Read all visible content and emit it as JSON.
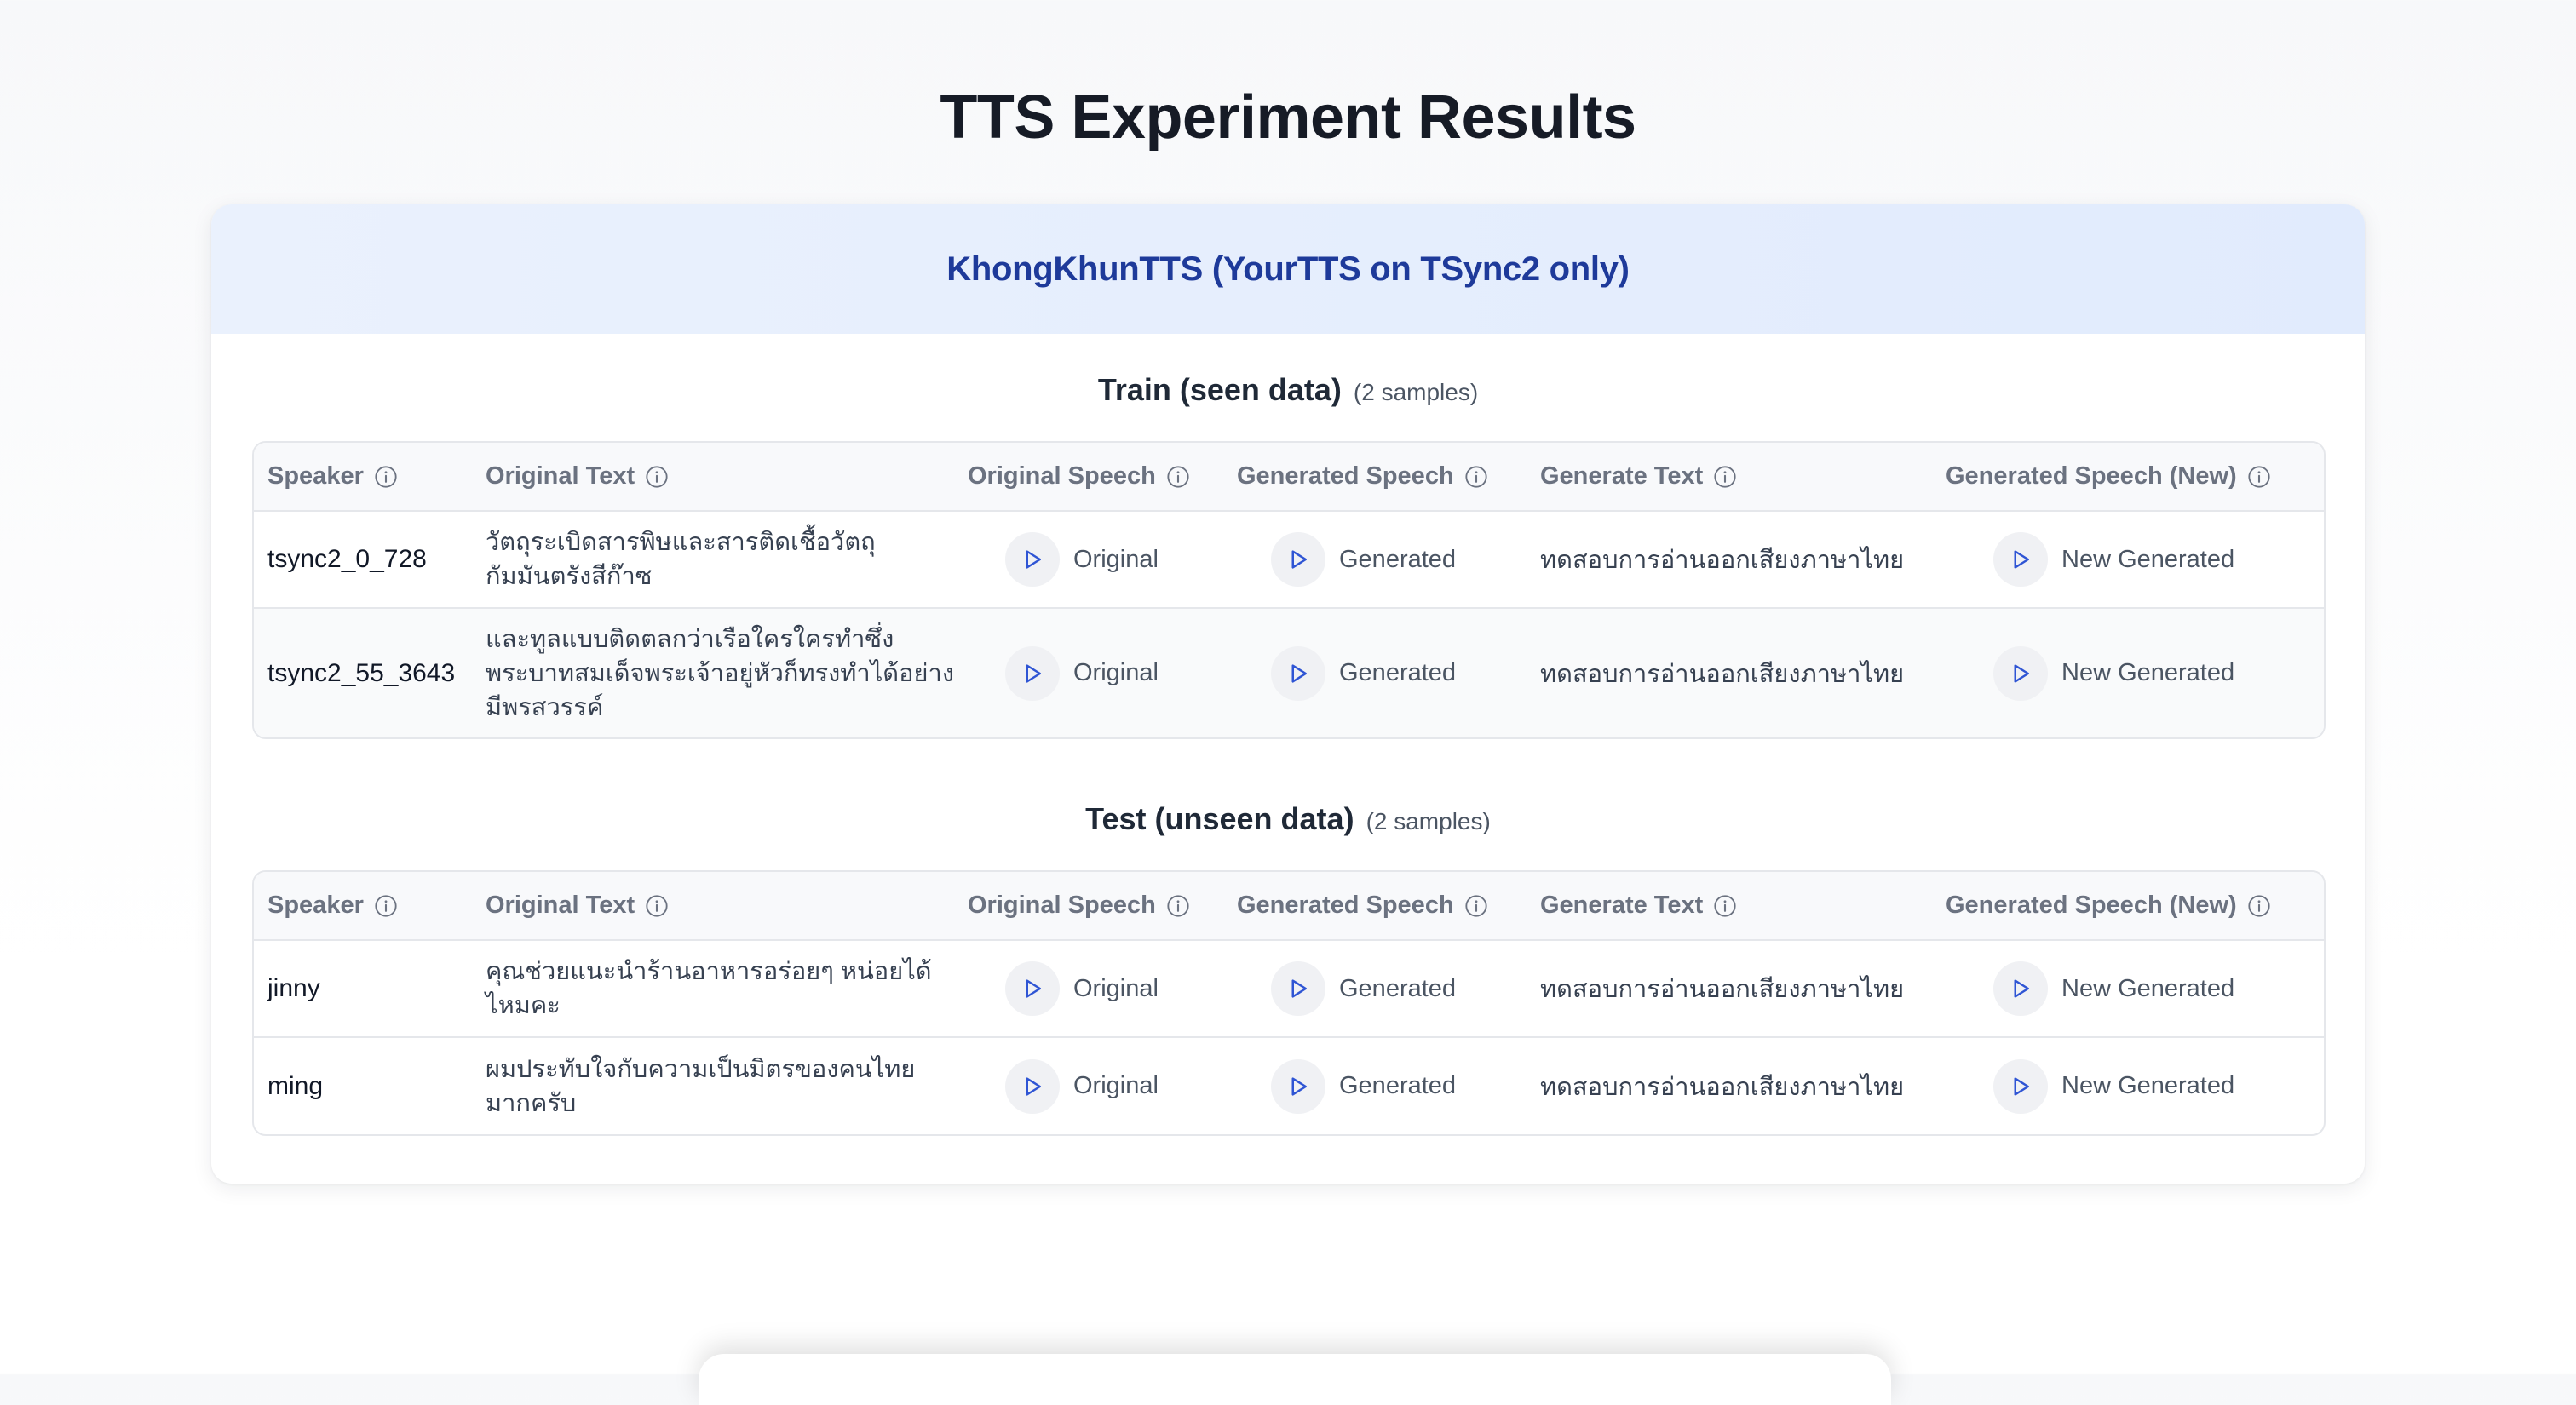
{
  "page": {
    "title": "TTS Experiment Results"
  },
  "card": {
    "title": "KhongKhunTTS (YourTTS on TSync2 only)"
  },
  "columns": [
    "Speaker",
    "Original Text",
    "Original Speech",
    "Generated Speech",
    "Generate Text",
    "Generated Speech (New)"
  ],
  "buttons": {
    "original": "Original",
    "generated": "Generated",
    "new_generated": "New Generated"
  },
  "sections": [
    {
      "title": "Train (seen data)",
      "count": "(2 samples)",
      "rows": [
        {
          "speaker": "tsync2_0_728",
          "original_text": "วัตถุระเบิดสารพิษและสารติดเชื้อวัตถุกัมมันตรังสีก๊าซ",
          "generate_text": "ทดสอบการอ่านออกเสียงภาษาไทย"
        },
        {
          "speaker": "tsync2_55_3643",
          "original_text": "และทูลแบบติดตลกว่าเรือใครใครทำซึ่งพระบาทสมเด็จพระเจ้าอยู่หัวก็ทรงทำได้อย่างมีพรสวรรค์",
          "generate_text": "ทดสอบการอ่านออกเสียงภาษาไทย"
        }
      ]
    },
    {
      "title": "Test (unseen data)",
      "count": "(2 samples)",
      "rows": [
        {
          "speaker": "jinny",
          "original_text": "คุณช่วยแนะนำร้านอาหารอร่อยๆ หน่อยได้ไหมคะ",
          "generate_text": "ทดสอบการอ่านออกเสียงภาษาไทย"
        },
        {
          "speaker": "ming",
          "original_text": "ผมประทับใจกับความเป็นมิตรของคนไทยมากครับ",
          "generate_text": "ทดสอบการอ่านออกเสียงภาษาไทย"
        }
      ]
    }
  ],
  "colors": {
    "accent": "#1e3a9a",
    "play_icon": "#2f55d4",
    "header_bg": "#e4edfd"
  },
  "icons": {
    "info": "info-circle-icon",
    "play": "play-icon"
  }
}
